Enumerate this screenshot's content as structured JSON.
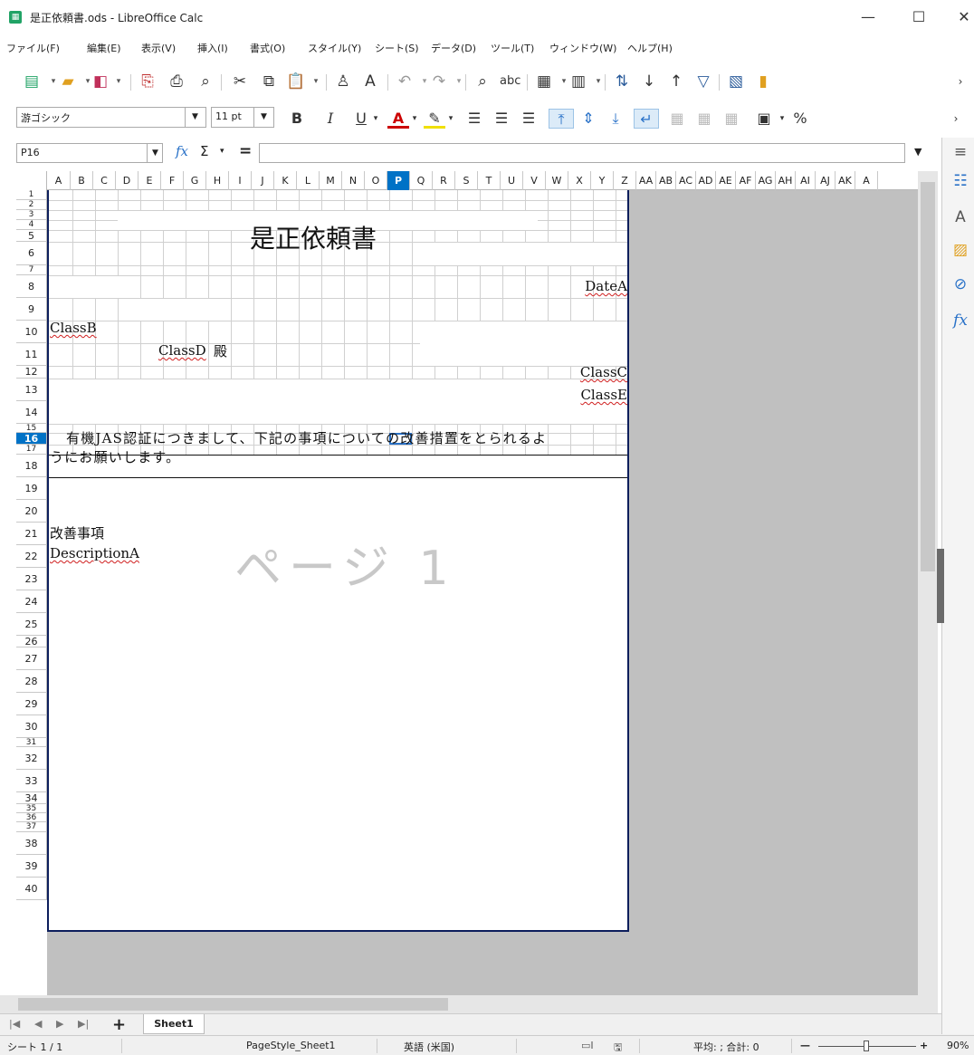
{
  "window": {
    "title": "是正依頼書.ods - LibreOffice Calc",
    "minimize": "—",
    "maximize": "☐",
    "close": "✕"
  },
  "menu": [
    "ファイル(F)",
    "編集(E)",
    "表示(V)",
    "挿入(I)",
    "書式(O)",
    "スタイル(Y)",
    "シート(S)",
    "データ(D)",
    "ツール(T)",
    "ウィンドウ(W)",
    "ヘルプ(H)"
  ],
  "format_toolbar": {
    "font_name": "游ゴシック",
    "font_size": "11 pt",
    "bold": "B",
    "italic": "I",
    "underline": "U",
    "percent": "%"
  },
  "formula_bar": {
    "cell_ref": "P16",
    "fx": "fx",
    "sum": "Σ",
    "equals": "="
  },
  "columns": [
    "A",
    "B",
    "C",
    "D",
    "E",
    "F",
    "G",
    "H",
    "I",
    "J",
    "K",
    "L",
    "M",
    "N",
    "O",
    "P",
    "Q",
    "R",
    "S",
    "T",
    "U",
    "V",
    "W",
    "X",
    "Y",
    "Z",
    "AA",
    "AB",
    "AC",
    "AD",
    "AE",
    "AF",
    "AG",
    "AH",
    "AI",
    "AJ",
    "AK",
    "A"
  ],
  "selected_column": "P",
  "rows": [
    "1",
    "2",
    "3",
    "4",
    "5",
    "6",
    "7",
    "8",
    "9",
    "10",
    "11",
    "12",
    "13",
    "14",
    "15",
    "16",
    "17",
    "18",
    "19",
    "20",
    "21",
    "22",
    "23",
    "24",
    "25",
    "26",
    "27",
    "28",
    "29",
    "30",
    "31",
    "32",
    "33",
    "34",
    "35",
    "36",
    "37",
    "38",
    "39",
    "40"
  ],
  "selected_row": "16",
  "document": {
    "title": "是正依頼書",
    "date_field": "DateA",
    "class_b": "ClassB",
    "class_d": "ClassD",
    "honorific": "殿",
    "class_c": "ClassC",
    "class_e": "ClassE",
    "body_line1": "有機JAS認証につきまして、下記の事項についての改善措置をとられるよ",
    "body_line2": "うにお願いします。",
    "section_heading": "改善事項",
    "description": "DescriptionA",
    "page_watermark": "ページ 1"
  },
  "sheet_tabs": {
    "active": "Sheet1",
    "add": "+"
  },
  "status_bar": {
    "sheet_pos": "シート 1 / 1",
    "page_style": "PageStyle_Sheet1",
    "language": "英語 (米国)",
    "summary": "平均: ; 合計: 0",
    "zoom": "90%"
  }
}
